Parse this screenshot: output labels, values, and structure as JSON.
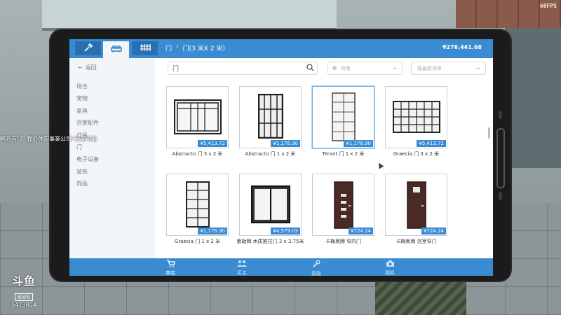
{
  "fps": "60FPS",
  "header": {
    "tabs": [
      {
        "icon": "hammer-icon"
      },
      {
        "icon": "sofa-icon"
      },
      {
        "icon": "fence-icon"
      }
    ],
    "breadcrumb": [
      "门",
      "门(3 米X 2 米)"
    ],
    "balance": "¥276,441.68"
  },
  "sidebar": {
    "back_label": "返回",
    "items": [
      "场合",
      "宠物",
      "家具",
      "浴室配件",
      "灯具",
      "门",
      "电子设备",
      "装饰",
      "饰品"
    ]
  },
  "search": {
    "value": "门"
  },
  "filters": {
    "category": "所有",
    "sort": "按最新排序"
  },
  "products": [
    {
      "name": "Abstracto 门 3 x 2 米",
      "price": "¥5,413.72"
    },
    {
      "name": "Abstracto 门 1 x 2 米",
      "price": "¥1,176.90"
    },
    {
      "name": "Terant 门 1 x 2 米",
      "price": "¥1,176.90"
    },
    {
      "name": "Graecia 门 3 x 2 米",
      "price": "¥5,413.72"
    },
    {
      "name": "Graecia 门 1 x 2 米",
      "price": "¥1,176.90"
    },
    {
      "name": "紫勒牌 木质推拉门 2 x 2.75米",
      "price": "¥4,579.03"
    },
    {
      "name": "卡梅奥牌 窄内门",
      "price": "¥724.24"
    },
    {
      "name": "卡梅奥牌 浴室窄门",
      "price": "¥724.24"
    }
  ],
  "bottom_nav": [
    {
      "label": "商店",
      "icon": "cart-icon"
    },
    {
      "label": "买主",
      "icon": "users-icon"
    },
    {
      "label": "技能",
      "icon": "wrench-icon"
    },
    {
      "label": "相机",
      "icon": "camera-icon"
    }
  ],
  "overlay": {
    "chat_user": "鸣芳吉只",
    "chat_text": "我沿休閒事業公司?分開可能",
    "logo": "斗鱼",
    "room_label": "房间号",
    "room_id": "5423804"
  },
  "colors": {
    "accent": "#3a8bd2",
    "selected_border": "#6fb3e8"
  }
}
